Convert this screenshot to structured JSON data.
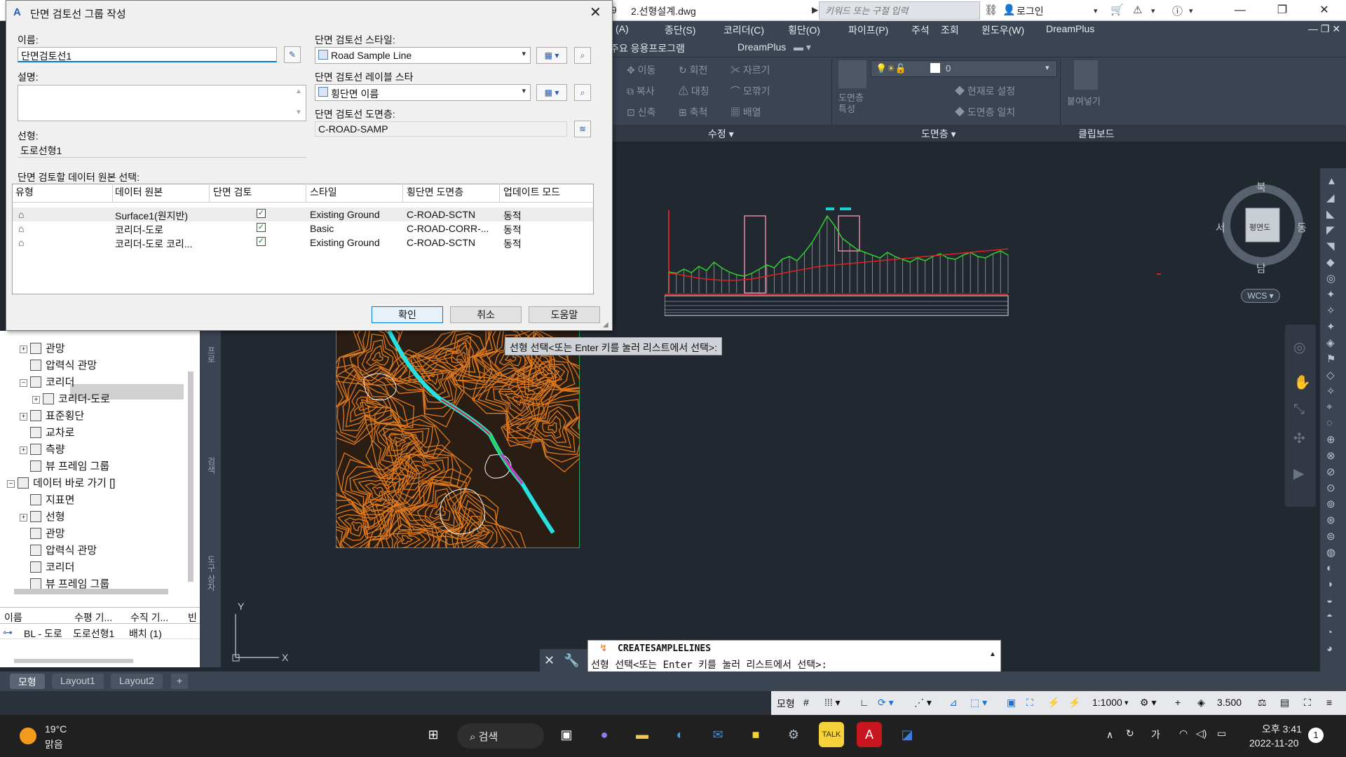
{
  "app": {
    "doc_title": "2.선형설계.dwg",
    "doc_prefix": "9",
    "search_placeholder": "키워드 또는 구절 입력",
    "login": "로그인",
    "win_min": "—",
    "win_max": "❐",
    "win_close": "✕"
  },
  "menu": [
    "(A)",
    "종단(S)",
    "코리더(C)",
    "횡단(O)",
    "파이프(P)",
    "주석",
    "조회",
    "윈도우(W)",
    "DreamPlus"
  ],
  "ribbon_tabs": [
    "주요 응용프로그램",
    "DreamPlus"
  ],
  "ribbon": {
    "modify_items": [
      "이동",
      "회전",
      "자르기",
      "복사",
      "대칭",
      "모깎기",
      "신축",
      "축척",
      "배열"
    ],
    "layer_items": [
      "도면층 특성",
      "현재로 설정",
      "도면층 일치"
    ],
    "layer_value": "0",
    "clip_item": "붙여넣기",
    "panel_modify": "수정",
    "panel_layer": "도면층",
    "panel_clip": "클립보드"
  },
  "dialog": {
    "title": "단면 검토선 그룹 작성",
    "name_label": "이름:",
    "name_value": "단면검토선1",
    "desc_label": "설명:",
    "align_label": "선형:",
    "align_value": "도로선형1",
    "style_label": "단면 검토선 스타일:",
    "style_value": "Road Sample Line",
    "label_style_label": "단면 검토선 레이블 스타",
    "label_style_value": "횡단면 이름",
    "layer_label": "단면 검토선 도면층:",
    "layer_value": "C-ROAD-SAMP",
    "source_label": "단면 검토할 데이터 원본 선택:",
    "columns": [
      "유형",
      "데이터 원본",
      "단면 검토",
      "스타일",
      "횡단면 도면층",
      "업데이트 모드"
    ],
    "rows": [
      {
        "source": "Surface1(원지반)",
        "sample": true,
        "style": "Existing Ground",
        "layer": "C-ROAD-SCTN",
        "mode": "동적"
      },
      {
        "source": "코리더-도로",
        "sample": true,
        "style": "Basic",
        "layer": "C-ROAD-CORR-...",
        "mode": "동적"
      },
      {
        "source": "코리더-도로 코리...",
        "sample": true,
        "style": "Existing Ground",
        "layer": "C-ROAD-SCTN",
        "mode": "동적"
      }
    ],
    "ok": "확인",
    "cancel": "취소",
    "help": "도움말"
  },
  "tree": {
    "items": [
      {
        "label": "관망",
        "indent": 1,
        "pm": "+"
      },
      {
        "label": "압력식 관망",
        "indent": 1,
        "pm": ""
      },
      {
        "label": "코리더",
        "indent": 1,
        "pm": "−"
      },
      {
        "label": "코리더-도로",
        "indent": 2,
        "pm": "+"
      },
      {
        "label": "표준횡단",
        "indent": 1,
        "pm": "+"
      },
      {
        "label": "교차로",
        "indent": 1,
        "pm": ""
      },
      {
        "label": "측량",
        "indent": 1,
        "pm": "+"
      },
      {
        "label": "뷰 프레임 그룹",
        "indent": 1,
        "pm": ""
      },
      {
        "label": "데이터 바로 가기 []",
        "indent": 0,
        "pm": "−"
      },
      {
        "label": "지표면",
        "indent": 1,
        "pm": ""
      },
      {
        "label": "선형",
        "indent": 1,
        "pm": "+"
      },
      {
        "label": "관망",
        "indent": 1,
        "pm": ""
      },
      {
        "label": "압력식 관망",
        "indent": 1,
        "pm": ""
      },
      {
        "label": "코리더",
        "indent": 1,
        "pm": ""
      },
      {
        "label": "뷰 프레임 그룹",
        "indent": 1,
        "pm": ""
      }
    ]
  },
  "sidetabs": [
    "프로",
    "검색",
    "도구 상자"
  ],
  "list": {
    "headers": [
      "이름",
      "수평 기...",
      "수직 기...",
      "빈"
    ],
    "row": [
      "BL - 도로",
      "도로선형1",
      "배치 (1)"
    ]
  },
  "tooltip": "선형 선택<또는 Enter 키를 눌러 리스트에서 선택>:",
  "viewcube": {
    "n": "북",
    "s": "남",
    "e": "동",
    "w": "서",
    "face": "평면도",
    "wcs": "WCS"
  },
  "command": {
    "name": "CREATESAMPLELINES",
    "prompt": "선형 선택<또는 Enter 키를 눌러 리스트에서 선택>:"
  },
  "layout_tabs": [
    "모형",
    "Layout1",
    "Layout2",
    "+"
  ],
  "status": {
    "model": "모형",
    "scale": "1:1000",
    "value": "3.500"
  },
  "taskbar": {
    "temp": "19°C",
    "weather": "맑음",
    "search": "검색",
    "ime": "가",
    "time": "오후 3:41",
    "date": "2022-11-20",
    "notif": "1"
  },
  "profile_data": {
    "ground": [
      30,
      28,
      34,
      29,
      38,
      32,
      44,
      36,
      30,
      26,
      24,
      28,
      34,
      40,
      36,
      48,
      52,
      46,
      58,
      72,
      90,
      110,
      96,
      78,
      70,
      62,
      58,
      54,
      50,
      58,
      52,
      48,
      44,
      50,
      46,
      52,
      56,
      50,
      48,
      54,
      58,
      52,
      50,
      56,
      60,
      54
    ],
    "design": [
      28,
      27,
      25,
      23,
      21,
      20,
      19,
      18,
      18,
      18,
      19,
      20,
      22,
      24,
      26,
      28,
      30,
      32,
      34,
      36,
      38,
      39,
      40,
      41,
      42,
      43,
      44,
      45,
      46,
      47,
      48,
      49,
      50,
      51,
      52,
      53,
      54,
      55,
      56,
      57,
      58,
      59,
      60,
      61,
      62,
      63
    ]
  }
}
